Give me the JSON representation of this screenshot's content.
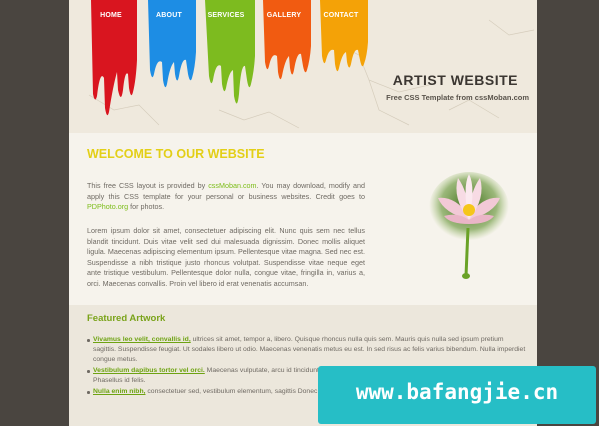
{
  "nav": {
    "items": [
      {
        "label": "HOME",
        "color": "#d9151f"
      },
      {
        "label": "ABOUT",
        "color": "#1d8de4"
      },
      {
        "label": "SERVICES",
        "color": "#7dbb1f"
      },
      {
        "label": "GALLERY",
        "color": "#f15b11"
      },
      {
        "label": "CONTACT",
        "color": "#f4a207"
      }
    ]
  },
  "header": {
    "title": "ARTIST WEBSITE",
    "subtitle": "Free CSS Template from cssMoban.com"
  },
  "welcome": {
    "heading": "WELCOME TO OUR WEBSITE",
    "p1_a": "This free CSS layout is provided by ",
    "p1_link1": "cssMoban.com",
    "p1_b": ". You may download, modify and apply this CSS template for your personal or business websites. Credit goes to ",
    "p1_link2": "PDPhoto.org",
    "p1_c": " for photos.",
    "p2": "Lorem ipsum dolor sit amet, consectetuer adipiscing elit. Nunc quis sem nec tellus blandit tincidunt. Duis vitae velit sed dui malesuada dignissim. Donec mollis aliquet ligula. Maecenas adipiscing elementum ipsum. Pellentesque vitae magna. Sed nec est. Suspendisse a nibh tristique justo rhoncus volutpat. Suspendisse vitae neque eget ante tristique vestibulum. Pellentesque dolor nulla, congue vitae, fringilla in, varius a, orci. Maecenas convallis. Proin vel libero id erat venenatis accumsan."
  },
  "featured": {
    "title": "Featured Artwork",
    "items": [
      {
        "link": "Vivamus leo velit, convallis id,",
        "text": " ultrices sit amet, tempor a, libero. Quisque rhoncus nulla quis sem. Mauris quis nulla sed ipsum pretium sagittis. Suspendisse feugiat. Ut sodales libero ut odio. Maecenas venenatis metus eu est. In sed risus ac felis varius bibendum. Nulla imperdiet congue metus."
      },
      {
        "link": "Vestibulum dapibus tortor vel orci.",
        "text": " Maecenas vulputate, arcu id tincidunt purus urna vel risus. Fusce vulputate tellus ac felis. Praesent Phasellus id felis."
      },
      {
        "link": "Nulla enim nibh,",
        "text": " consectetuer sed, vestibulum elementum, sagittis Donec venenatis. Cras urna metus, feugiat non, consectetuer quis"
      }
    ]
  },
  "watermark": {
    "text": "www.bafangjie.cn"
  }
}
